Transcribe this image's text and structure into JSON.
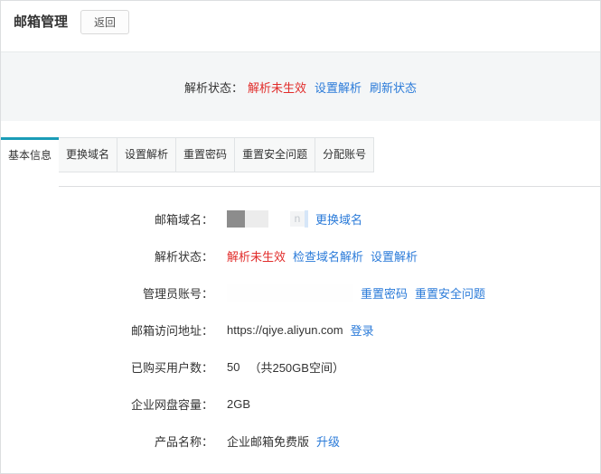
{
  "page": {
    "title": "邮箱管理",
    "back_button": "返回"
  },
  "banner": {
    "label": "解析状态：",
    "status": "解析未生效",
    "links": [
      "设置解析",
      "刷新状态"
    ]
  },
  "tabs": [
    {
      "label": "基本信息",
      "active": true
    },
    {
      "label": "更换域名",
      "active": false
    },
    {
      "label": "设置解析",
      "active": false
    },
    {
      "label": "重置密码",
      "active": false
    },
    {
      "label": "重置安全问题",
      "active": false
    },
    {
      "label": "分配账号",
      "active": false
    }
  ],
  "info": {
    "domain": {
      "label": "邮箱域名：",
      "redacted_hint": "n",
      "link": "更换域名"
    },
    "resolution": {
      "label": "解析状态：",
      "status": "解析未生效",
      "links": [
        "检查域名解析",
        "设置解析"
      ]
    },
    "admin": {
      "label": "管理员账号：",
      "links": [
        "重置密码",
        "重置安全问题"
      ]
    },
    "access": {
      "label": "邮箱访问地址：",
      "value": "https://qiye.aliyun.com",
      "link": "登录"
    },
    "users": {
      "label": "已购买用户数：",
      "value": "50",
      "note": "（共250GB空间）"
    },
    "disk": {
      "label": "企业网盘容量：",
      "value": "2GB"
    },
    "product": {
      "label": "产品名称：",
      "value": "企业邮箱免费版",
      "link": "升级"
    }
  },
  "colors": {
    "accent_teal": "#1a9cb7",
    "link_blue": "#2b7bd9",
    "error_red": "#e12d2b",
    "banner_bg": "#f4f6f7",
    "border": "#dcdee0"
  }
}
